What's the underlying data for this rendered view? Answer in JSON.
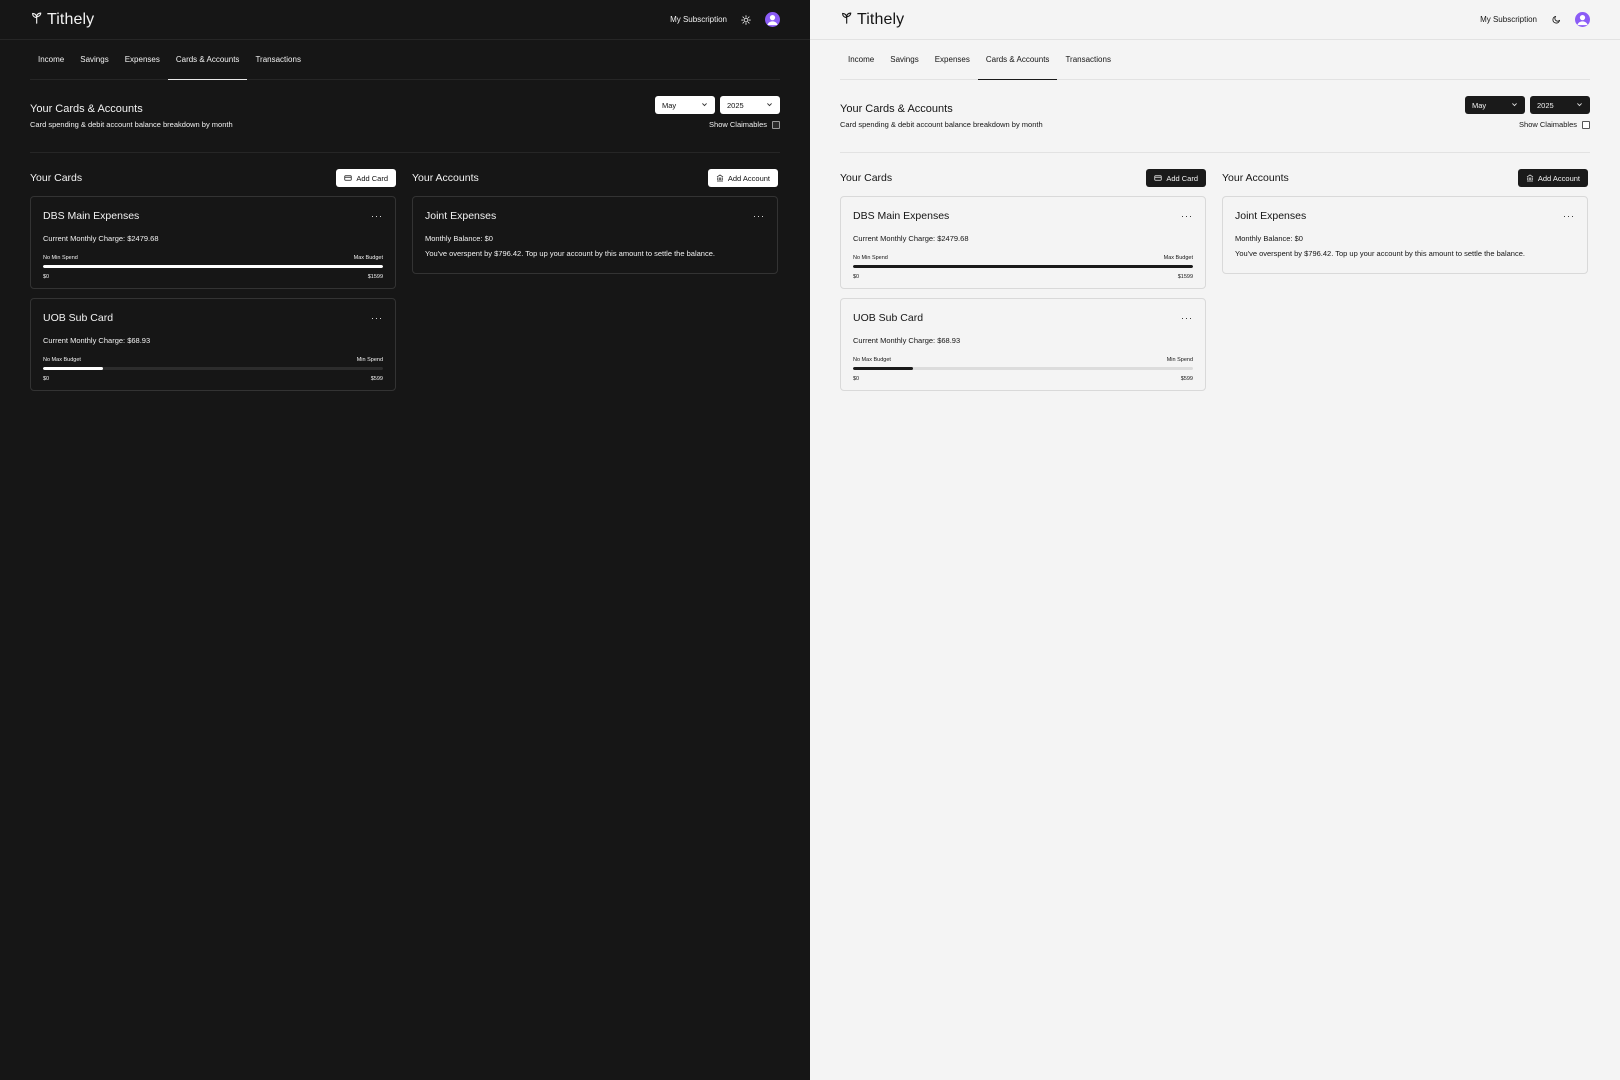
{
  "app": {
    "brand_name": "Tithely",
    "subscription_link": "My Subscription"
  },
  "tabs": [
    {
      "label": "Income"
    },
    {
      "label": "Savings"
    },
    {
      "label": "Expenses"
    },
    {
      "label": "Cards & Accounts",
      "active": true
    },
    {
      "label": "Transactions"
    }
  ],
  "page": {
    "title": "Your Cards & Accounts",
    "subtitle": "Card spending & debit account balance breakdown by month",
    "month": "May",
    "year": "2025",
    "show_claimables_label": "Show Claimables"
  },
  "cards_section": {
    "title": "Your Cards",
    "add_label": "Add Card",
    "cards": [
      {
        "name": "DBS Main Expenses",
        "charge": "Current Monthly Charge: $2479.68",
        "left_label": "No Min Spend",
        "right_label": "Max Budget",
        "min": "$0",
        "max": "$1599",
        "progress": 1.0
      },
      {
        "name": "UOB Sub Card",
        "charge": "Current Monthly Charge: $68.93",
        "left_label": "No Max Budget",
        "right_label": "Min Spend",
        "min": "$0",
        "max": "$599",
        "progress": 0.175
      }
    ]
  },
  "accounts_section": {
    "title": "Your Accounts",
    "add_label": "Add Account",
    "accounts": [
      {
        "name": "Joint Expenses",
        "balance": "Monthly Balance: $0",
        "note": "You've overspent by $796.42. Top up your account by this amount to settle the balance."
      }
    ]
  },
  "more_glyph": "···",
  "theme": {
    "dark_bg": "#161616",
    "light_bg": "#f4f4f4",
    "avatar_color": "#8b5cf6"
  }
}
